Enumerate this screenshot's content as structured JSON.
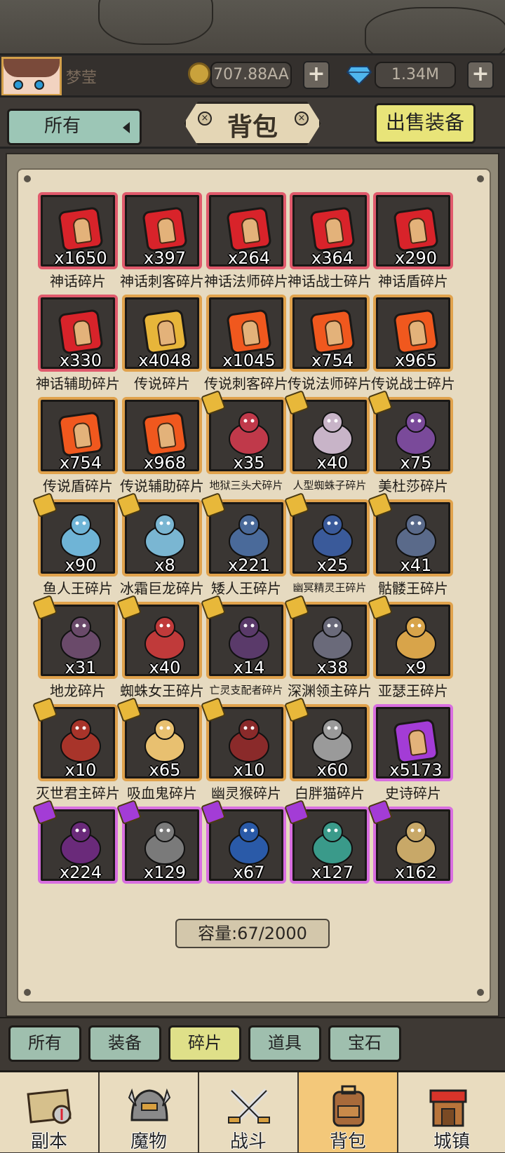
{
  "player": {
    "name": "梦莹"
  },
  "currency": {
    "gold": "707.88AA",
    "gems": "1.34M",
    "add_label": "+"
  },
  "header": {
    "filter_label": "所有",
    "title": "背包",
    "sell_label": "出售装备",
    "close_glyph": "×"
  },
  "items": [
    {
      "count": "x1650",
      "name": "神话碎片",
      "rarity": "red",
      "kind": "piece",
      "color": "#d8232a"
    },
    {
      "count": "x397",
      "name": "神话刺客碎片",
      "rarity": "red",
      "kind": "piece",
      "color": "#d8232a"
    },
    {
      "count": "x264",
      "name": "神话法师碎片",
      "rarity": "red",
      "kind": "piece",
      "color": "#d8232a"
    },
    {
      "count": "x364",
      "name": "神话战士碎片",
      "rarity": "red",
      "kind": "piece",
      "color": "#d8232a"
    },
    {
      "count": "x290",
      "name": "神话盾碎片",
      "rarity": "red",
      "kind": "piece",
      "color": "#d8232a"
    },
    {
      "count": "x330",
      "name": "神话辅助碎片",
      "rarity": "red",
      "kind": "piece",
      "color": "#d8232a"
    },
    {
      "count": "x4048",
      "name": "传说碎片",
      "rarity": "orange",
      "kind": "piece",
      "color": "#e7b53a"
    },
    {
      "count": "x1045",
      "name": "传说刺客碎片",
      "rarity": "orange",
      "kind": "piece",
      "color": "#f0581e"
    },
    {
      "count": "x754",
      "name": "传说法师碎片",
      "rarity": "orange",
      "kind": "piece",
      "color": "#f0581e"
    },
    {
      "count": "x965",
      "name": "传说战士碎片",
      "rarity": "orange",
      "kind": "piece",
      "color": "#f0581e"
    },
    {
      "count": "x754",
      "name": "传说盾碎片",
      "rarity": "orange",
      "kind": "piece",
      "color": "#f0581e"
    },
    {
      "count": "x968",
      "name": "传说辅助碎片",
      "rarity": "orange",
      "kind": "piece",
      "color": "#f0581e"
    },
    {
      "count": "x35",
      "name": "地狱三头犬碎片",
      "rarity": "orange",
      "kind": "monster",
      "color": "#c0394a",
      "small": true
    },
    {
      "count": "x40",
      "name": "人型蜘蛛子碎片",
      "rarity": "orange",
      "kind": "monster",
      "color": "#c8b4c8",
      "small": true
    },
    {
      "count": "x75",
      "name": "美杜莎碎片",
      "rarity": "orange",
      "kind": "monster",
      "color": "#7a4a9a"
    },
    {
      "count": "x90",
      "name": "鱼人王碎片",
      "rarity": "orange",
      "kind": "monster",
      "color": "#6fb4d6"
    },
    {
      "count": "x8",
      "name": "冰霜巨龙碎片",
      "rarity": "orange",
      "kind": "monster",
      "color": "#7ab6d2"
    },
    {
      "count": "x221",
      "name": "矮人王碎片",
      "rarity": "orange",
      "kind": "monster",
      "color": "#4a6a9a"
    },
    {
      "count": "x25",
      "name": "幽冥精灵王碎片",
      "rarity": "orange",
      "kind": "monster",
      "color": "#3a5a9a",
      "small": true
    },
    {
      "count": "x41",
      "name": "骷髅王碎片",
      "rarity": "orange",
      "kind": "monster",
      "color": "#5a6a8a"
    },
    {
      "count": "x31",
      "name": "地龙碎片",
      "rarity": "orange",
      "kind": "monster",
      "color": "#6a4a6a"
    },
    {
      "count": "x40",
      "name": "蜘蛛女王碎片",
      "rarity": "orange",
      "kind": "monster",
      "color": "#c03a3a"
    },
    {
      "count": "x14",
      "name": "亡灵支配者碎片",
      "rarity": "orange",
      "kind": "monster",
      "color": "#5a3a6a",
      "small": true
    },
    {
      "count": "x38",
      "name": "深渊领主碎片",
      "rarity": "orange",
      "kind": "monster",
      "color": "#6a6a7a"
    },
    {
      "count": "x9",
      "name": "亚瑟王碎片",
      "rarity": "orange",
      "kind": "monster",
      "color": "#d8a44a"
    },
    {
      "count": "x10",
      "name": "灭世君主碎片",
      "rarity": "orange",
      "kind": "monster",
      "color": "#a8342a"
    },
    {
      "count": "x65",
      "name": "吸血鬼碎片",
      "rarity": "orange",
      "kind": "monster",
      "color": "#e8c070"
    },
    {
      "count": "x10",
      "name": "幽灵猴碎片",
      "rarity": "orange",
      "kind": "monster",
      "color": "#8a2a2a"
    },
    {
      "count": "x60",
      "name": "白胖猫碎片",
      "rarity": "orange",
      "kind": "monster",
      "color": "#9a9a9a"
    },
    {
      "count": "x5173",
      "name": "史诗碎片",
      "rarity": "purple",
      "kind": "piece",
      "color": "#a33cd6"
    },
    {
      "count": "x224",
      "name": "",
      "rarity": "purple",
      "kind": "monster",
      "color": "#6a2a7a"
    },
    {
      "count": "x129",
      "name": "",
      "rarity": "purple",
      "kind": "monster",
      "color": "#7a7a7a"
    },
    {
      "count": "x67",
      "name": "",
      "rarity": "purple",
      "kind": "monster",
      "color": "#2a5aa8"
    },
    {
      "count": "x127",
      "name": "",
      "rarity": "purple",
      "kind": "monster",
      "color": "#3a9a8a"
    },
    {
      "count": "x162",
      "name": "",
      "rarity": "purple",
      "kind": "monster",
      "color": "#c8a868"
    }
  ],
  "capacity": "容量:67/2000",
  "category_tabs": [
    {
      "label": "所有",
      "active": false
    },
    {
      "label": "装备",
      "active": false
    },
    {
      "label": "碎片",
      "active": true
    },
    {
      "label": "道具",
      "active": false
    },
    {
      "label": "宝石",
      "active": false
    }
  ],
  "bottom_nav": [
    {
      "label": "副本",
      "icon": "map-icon",
      "active": false
    },
    {
      "label": "魔物",
      "icon": "monster-helmet-icon",
      "active": false
    },
    {
      "label": "战斗",
      "icon": "crossed-swords-icon",
      "active": false
    },
    {
      "label": "背包",
      "icon": "backpack-icon",
      "active": true
    },
    {
      "label": "城镇",
      "icon": "shop-icon",
      "active": false
    }
  ]
}
